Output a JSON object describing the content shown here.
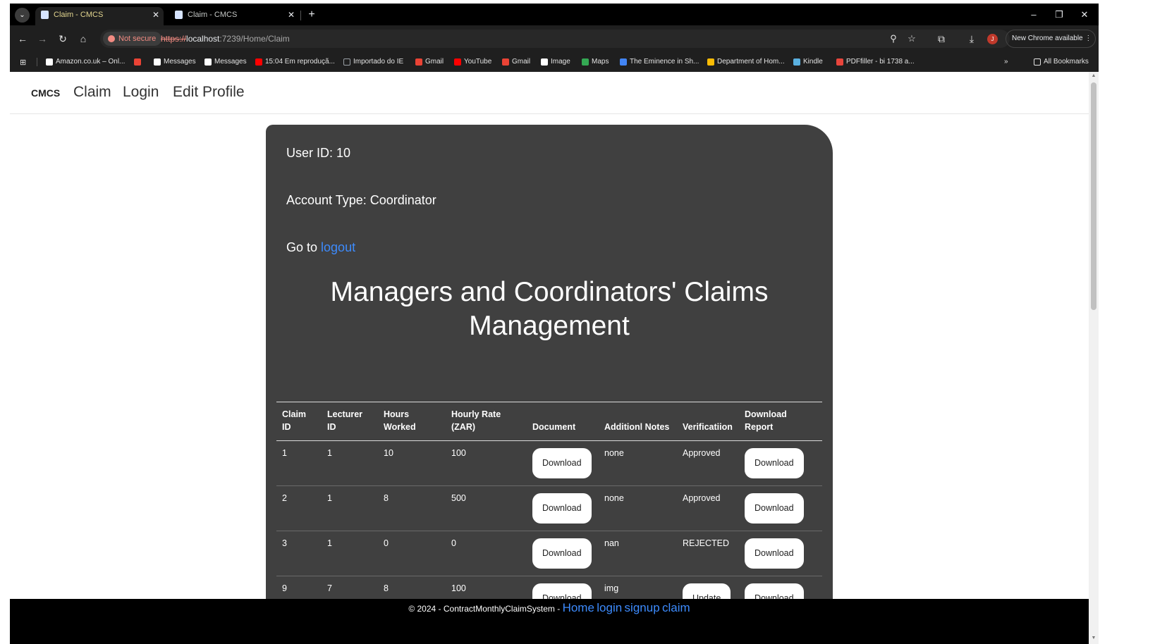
{
  "browser": {
    "tabs": [
      {
        "title": "Claim - CMCS",
        "active": true
      },
      {
        "title": "Claim - CMCS",
        "active": false
      }
    ],
    "security_label": "Not secure",
    "url_scheme": "https://",
    "url_host": "localhost",
    "url_rest": ":7239/Home/Claim",
    "new_chrome_label": "New Chrome available",
    "avatar_letter": "J",
    "bookmarks": [
      {
        "label": "Amazon.co.uk – Onl...",
        "color": "#ffffff"
      },
      {
        "label": "",
        "color": "#ea4335"
      },
      {
        "label": "Messages",
        "color": "#ffffff"
      },
      {
        "label": "Messages",
        "color": "#ffffff"
      },
      {
        "label": "15:04 Em reproduçã...",
        "color": "#ff0000"
      },
      {
        "label": "Importado do IE",
        "color": "#9aa0a6"
      },
      {
        "label": "Gmail",
        "color": "#ea4335"
      },
      {
        "label": "YouTube",
        "color": "#ff0000"
      },
      {
        "label": "Gmail",
        "color": "#ea4335"
      },
      {
        "label": "Image",
        "color": "#ffffff"
      },
      {
        "label": "Maps",
        "color": "#34a853"
      },
      {
        "label": "The Eminence in Sh...",
        "color": "#4285f4"
      },
      {
        "label": "Department of Hom...",
        "color": "#fbbc05"
      },
      {
        "label": "Kindle",
        "color": "#5ab0e0"
      },
      {
        "label": "PDFfiller - bi 1738 a...",
        "color": "#e8453c"
      }
    ],
    "more_bookmarks": "»",
    "all_bookmarks": "All Bookmarks"
  },
  "site_nav": {
    "brand": "CMCS",
    "links": [
      "Claim",
      "Login",
      "Edit Profile"
    ]
  },
  "user_info": {
    "user_id": "User ID: 10",
    "account_type": "Account Type: Coordinator",
    "goto_prefix": "Go to ",
    "logout_link": "logout"
  },
  "heading": "Managers and Coordinators' Claims Management",
  "table": {
    "headers": [
      "Claim ID",
      "Lecturer ID",
      "Hours Worked",
      "Hourly Rate (ZAR)",
      "Document",
      "Additionl Notes",
      "Verificatiion",
      "Download Report"
    ],
    "rows": [
      {
        "claim_id": "1",
        "lecturer_id": "1",
        "hours": "10",
        "rate": "100",
        "document": "Download",
        "notes": "none",
        "verification": "Approved",
        "report": "Download"
      },
      {
        "claim_id": "2",
        "lecturer_id": "1",
        "hours": "8",
        "rate": "500",
        "document": "Download",
        "notes": "none",
        "verification": "Approved",
        "report": "Download"
      },
      {
        "claim_id": "3",
        "lecturer_id": "1",
        "hours": "0",
        "rate": "0",
        "document": "Download",
        "notes": "nan",
        "verification": "REJECTED",
        "report": "Download"
      },
      {
        "claim_id": "9",
        "lecturer_id": "7",
        "hours": "8",
        "rate": "100",
        "document": "Download",
        "notes": "img",
        "verification": "Update",
        "report": "Download"
      }
    ]
  },
  "footer": {
    "copyright": "© 2024 - ContractMonthlyClaimSystem - ",
    "links": [
      "Home",
      "login",
      "signup",
      "claim"
    ]
  }
}
